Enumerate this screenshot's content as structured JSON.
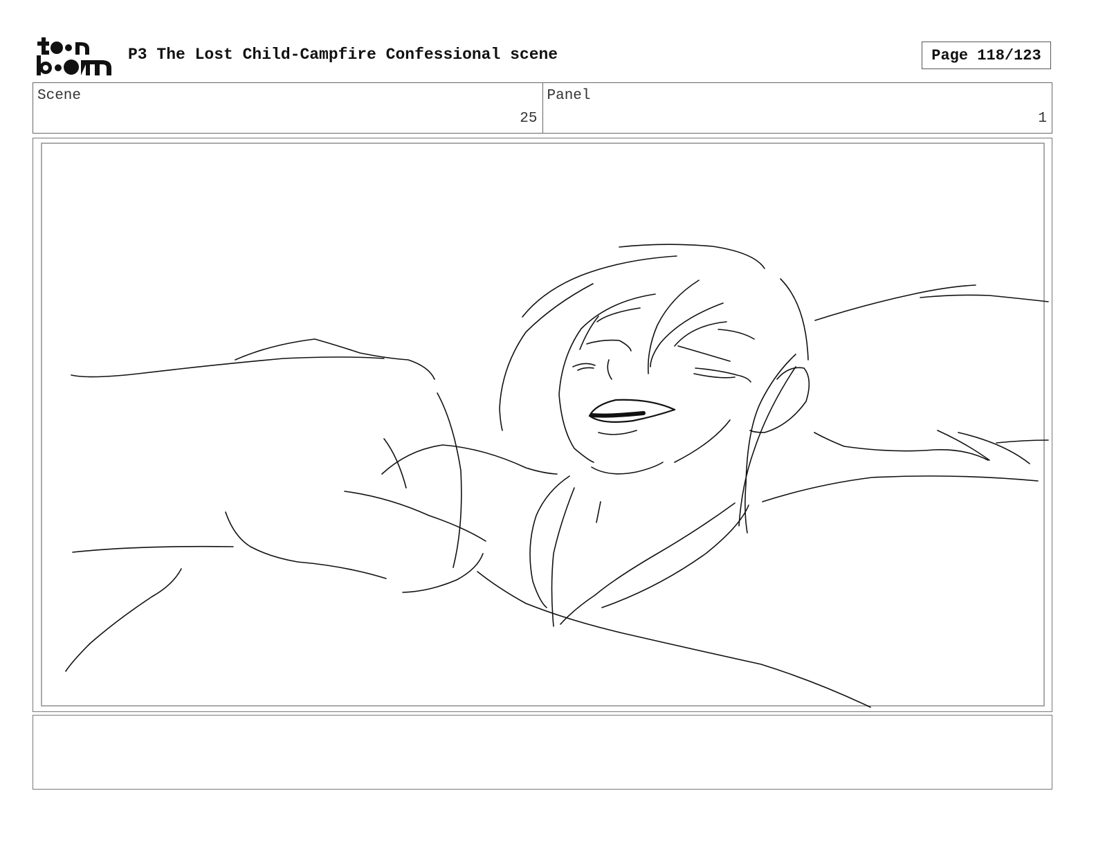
{
  "header": {
    "logo_alt": "toon boom",
    "title": "P3 The Lost Child-Campfire Confessional scene",
    "page": "Page 118/123"
  },
  "info": {
    "scene_label": "Scene",
    "scene_value": "25",
    "panel_label": "Panel",
    "panel_value": "1"
  },
  "notes": {
    "text": ""
  }
}
